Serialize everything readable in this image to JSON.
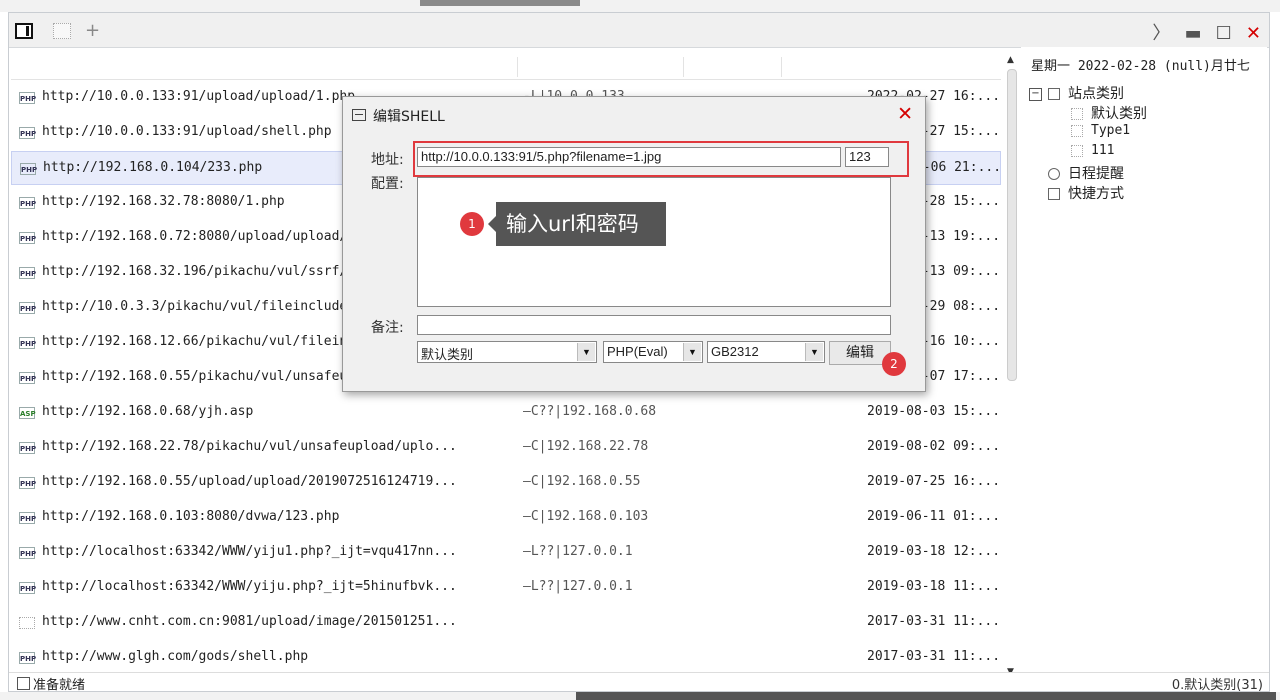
{
  "tabs": {
    "add_label": "+"
  },
  "window_controls": {
    "next": "〉",
    "minimize": "▬",
    "maximize": "☐",
    "close": "✕"
  },
  "rows": [
    {
      "type": "php",
      "url": "http://10.0.0.133:91/upload/upload/1.php",
      "ip": "-L|10.0.0.133",
      "date": "2022-02-27 16:..."
    },
    {
      "type": "php",
      "url": "http://10.0.0.133:91/upload/shell.php",
      "ip": "",
      "date": "2022-02-27 15:..."
    },
    {
      "type": "php",
      "url": "http://192.168.0.104/233.php",
      "ip": "",
      "date": "2022-02-06 21:...",
      "selected": true
    },
    {
      "type": "php",
      "url": "http://192.168.32.78:8080/1.php",
      "ip": "",
      "date": "2022-01-28 15:..."
    },
    {
      "type": "php",
      "url": "http://192.168.0.72:8080/upload/upload/m",
      "ip": "",
      "date": "2021-12-13 19:..."
    },
    {
      "type": "php",
      "url": "http://192.168.32.196/pikachu/vul/ssrf/s",
      "ip": "",
      "date": "2021-12-13 09:..."
    },
    {
      "type": "php",
      "url": "http://10.0.3.3/pikachu/vul/fileinclude/",
      "ip": "",
      "date": "2021-11-29 08:..."
    },
    {
      "type": "php",
      "url": "http://192.168.12.66/pikachu/vul/fileinc",
      "ip": "",
      "date": "2021-11-16 10:..."
    },
    {
      "type": "php",
      "url": "http://192.168.0.55/pikachu/vul/unsafeup",
      "ip": "",
      "date": "2019-09-07 17:..."
    },
    {
      "type": "asp",
      "url": "http://192.168.0.68/yjh.asp",
      "ip": "—C??|192.168.0.68",
      "date": "2019-08-03 15:..."
    },
    {
      "type": "php",
      "url": "http://192.168.22.78/pikachu/vul/unsafeupload/uplo...",
      "ip": "—C|192.168.22.78",
      "date": "2019-08-02 09:..."
    },
    {
      "type": "php",
      "url": "http://192.168.0.55/upload/upload/2019072516124719...",
      "ip": "—C|192.168.0.55",
      "date": "2019-07-25 16:..."
    },
    {
      "type": "php",
      "url": "http://192.168.0.103:8080/dvwa/123.php",
      "ip": "—C|192.168.0.103",
      "date": "2019-06-11 01:..."
    },
    {
      "type": "php",
      "url": "http://localhost:63342/WWW/yiju1.php?_ijt=vqu417nn...",
      "ip": "—L??|127.0.0.1",
      "date": "2019-03-18 12:..."
    },
    {
      "type": "php",
      "url": "http://localhost:63342/WWW/yiju.php?_ijt=5hinufbvk...",
      "ip": "—L??|127.0.0.1",
      "date": "2019-03-18 11:..."
    },
    {
      "type": "blank",
      "url": "http://www.cnht.com.cn:9081/upload/image/201501251...",
      "ip": "",
      "date": "2017-03-31 11:..."
    },
    {
      "type": "php",
      "url": "http://www.glgh.com/gods/shell.php",
      "ip": "",
      "date": "2017-03-31 11:..."
    }
  ],
  "right_panel": {
    "date": "星期一 2022-02-28 (null)月廿七",
    "tree": {
      "root": "站点类别",
      "children": [
        "默认类别",
        "Type1",
        "111"
      ],
      "schedule": "日程提醒",
      "shortcuts": "快捷方式"
    }
  },
  "status": {
    "left": "准备就绪",
    "right": "0.默认类别(31)"
  },
  "dialog": {
    "title": "编辑SHELL",
    "close": "✕",
    "address_label": "地址:",
    "address_value": "http://10.0.0.133:91/5.php?filename=1.jpg",
    "password_value": "123",
    "config_label": "配置:",
    "note_label": "备注:",
    "note_value": "",
    "category": "默认类别",
    "type": "PHP(Eval)",
    "encoding": "GB2312",
    "edit_button": "编辑"
  },
  "annotations": {
    "step1_number": "1",
    "step1_text": "输入url和密码",
    "step2_number": "2"
  },
  "colors": {
    "annotation_red": "#e0393e",
    "tooltip_bg": "#555555",
    "selection_bg": "#e8ecfb"
  }
}
